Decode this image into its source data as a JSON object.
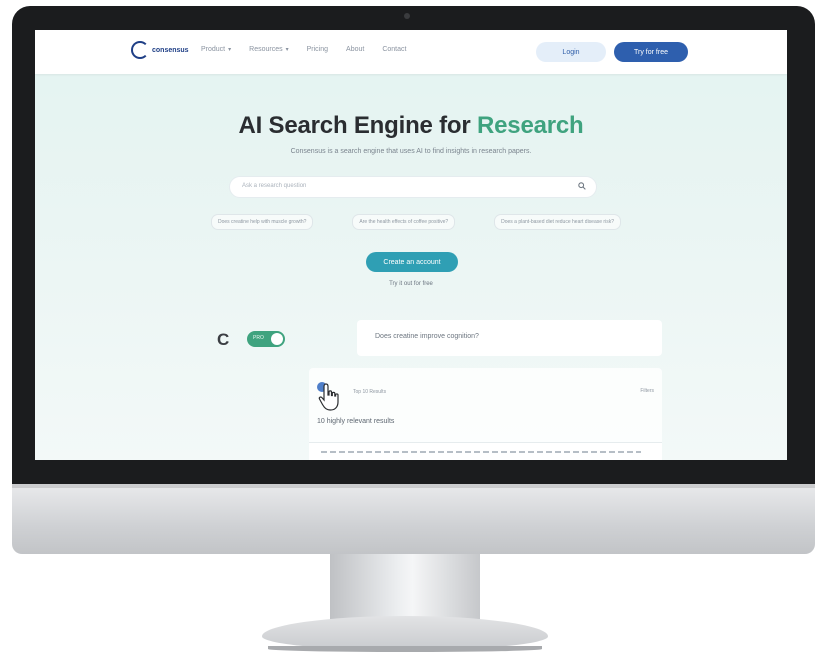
{
  "nav": {
    "logo_text": "consensus",
    "links": [
      {
        "label": "Product",
        "has_dropdown": true
      },
      {
        "label": "Resources",
        "has_dropdown": true
      },
      {
        "label": "Pricing",
        "has_dropdown": false
      },
      {
        "label": "About",
        "has_dropdown": false
      },
      {
        "label": "Contact",
        "has_dropdown": false
      }
    ],
    "login_label": "Login",
    "try_label": "Try for free"
  },
  "hero": {
    "title_main": "AI Search Engine for ",
    "title_accent": "Research",
    "subtitle": "Consensus is a search engine that uses AI to find insights in research papers."
  },
  "search": {
    "placeholder": "Ask a research question"
  },
  "chips": [
    "Does creatine help with muscle growth?",
    "Are the health effects of coffee positive?",
    "Does a plant-based diet reduce heart disease risk?"
  ],
  "cta": {
    "create_label": "Create an account",
    "try_link": "Try it out for free"
  },
  "demo": {
    "c_glyph": "C",
    "toggle_label": "PRO",
    "question": "Does creatine improve cognition?",
    "result_source": "Top 10 Results",
    "filter_label": "Filters",
    "result_heading": "10 highly relevant results"
  },
  "colors": {
    "accent_green": "#3fa37f",
    "brand_blue": "#2e5fae",
    "cta_teal": "#2f9fb4",
    "bezel": "#1b1c1e"
  }
}
